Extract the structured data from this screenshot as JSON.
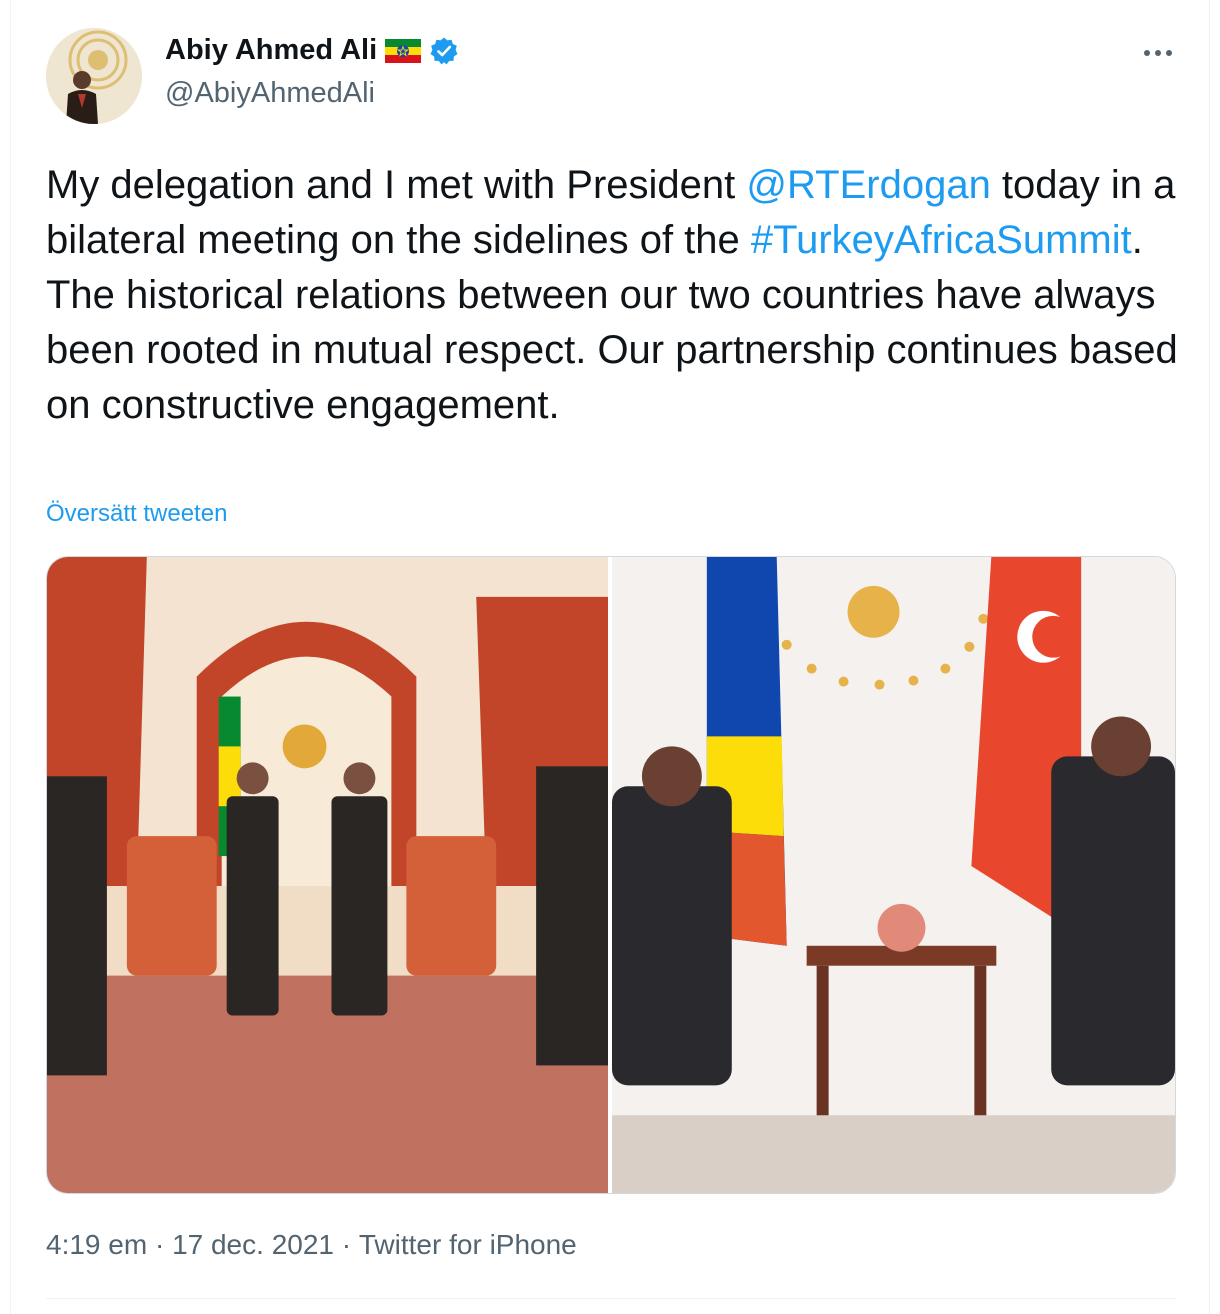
{
  "author": {
    "display_name": "Abiy Ahmed Ali",
    "handle": "@AbiyAhmedAli",
    "flag_icon": "ethiopia-flag-icon",
    "verified_icon": "verified-badge-icon",
    "avatar_icon": "profile-photo-avatar"
  },
  "tweet": {
    "text_1": "My delegation and I met with President ",
    "mention": "@RTErdogan",
    "text_2": " today in a bilateral meeting on the sidelines of the ",
    "hashtag": "#TurkeyAfricaSummit",
    "text_3": ". The historical relations between our two countries have always been rooted in mutual respect. Our partnership continues based on constructive engagement.",
    "translate_label": "Översätt tweeten"
  },
  "media": {
    "photo_count": 2,
    "photos": [
      {
        "icon": "photo-delegation-standing"
      },
      {
        "icon": "photo-leaders-seated"
      }
    ]
  },
  "meta": {
    "time": "4:19 em",
    "separator": " · ",
    "date": "17 dec. 2021",
    "source": "Twitter for iPhone"
  },
  "colors": {
    "link": "#1d9bf0",
    "text": "#0f1419",
    "secondary": "#536471",
    "border": "#cfd9de"
  },
  "more_icon": "more-options-icon"
}
